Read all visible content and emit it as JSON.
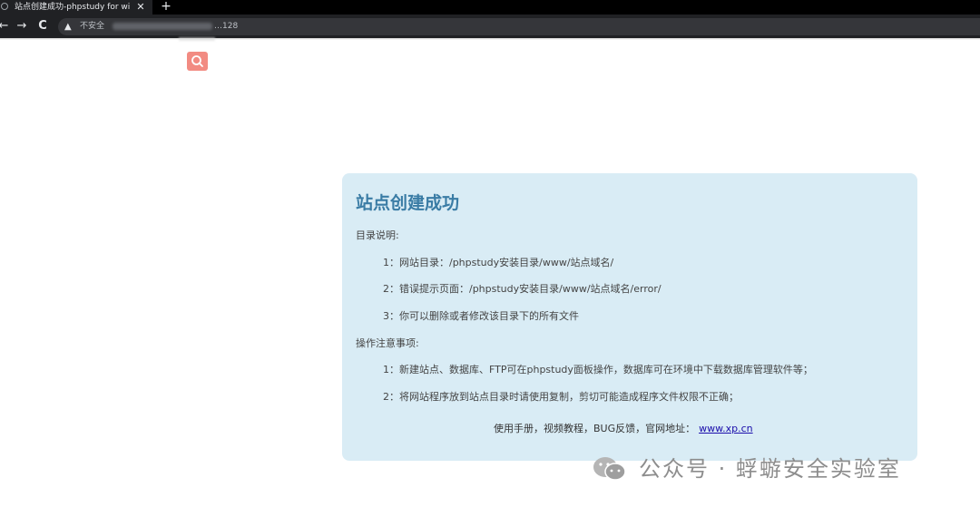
{
  "browser": {
    "tab_title": "站点创建成功-phpstudy for wi",
    "tab_close": "✕",
    "new_tab": "+",
    "back": "←",
    "forward": "→",
    "reload": "C",
    "security_label": "不安全",
    "address": "…128"
  },
  "page": {
    "title": "站点创建成功",
    "dir_heading": "目录说明:",
    "dir_items": [
      "1：网站目录：/phpstudy安装目录/www/站点域名/",
      "2：错误提示页面：/phpstudy安装目录/www/站点域名/error/",
      "3：你可以删除或者修改该目录下的所有文件"
    ],
    "notes_heading": "操作注意事项:",
    "notes_items": [
      "1：新建站点、数据库、FTP可在phpstudy面板操作，数据库可在环境中下载数据库管理软件等；",
      "2：将网站程序放到站点目录时请使用复制，剪切可能造成程序文件权限不正确；"
    ],
    "footer_text": "使用手册，视频教程，BUG反馈，官网地址：",
    "footer_link": "www.xp.cn"
  },
  "watermark": {
    "text": "公众号 · 蜉蝣安全实验室"
  },
  "colors": {
    "panel_bg": "#d9ecf5",
    "title": "#3a7ca5",
    "search_badge": "#f28b82",
    "link": "#1a0dab"
  }
}
